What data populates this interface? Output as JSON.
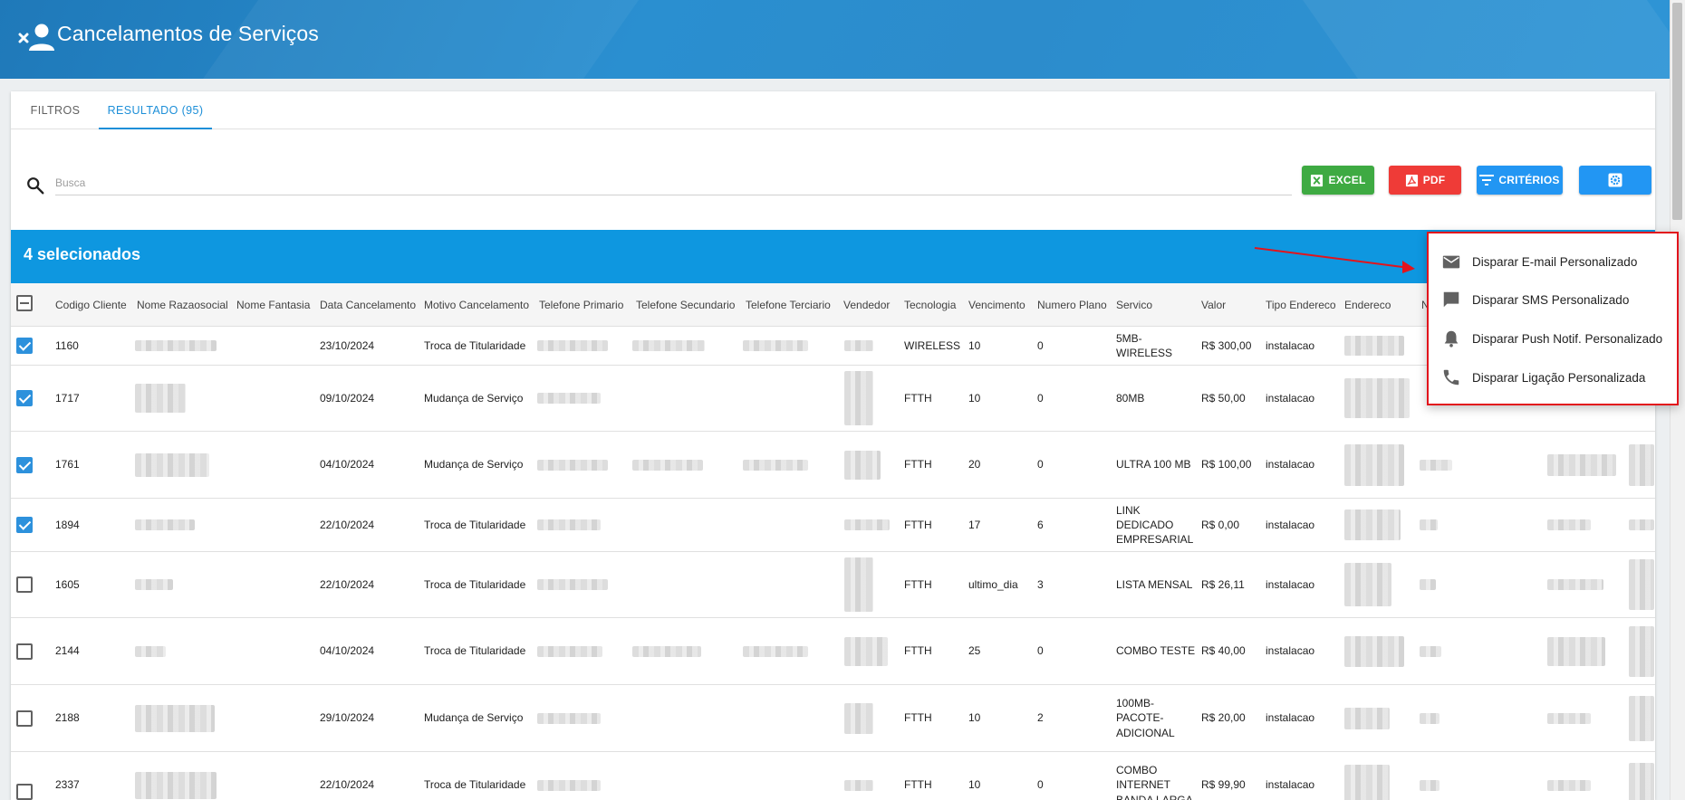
{
  "header": {
    "title": "Cancelamentos de Serviços"
  },
  "tabs": [
    {
      "label": "FILTROS"
    },
    {
      "label": "RESULTADO (95)"
    }
  ],
  "search": {
    "placeholder": "Busca",
    "value": ""
  },
  "toolbar": {
    "excel_label": "EXCEL",
    "pdf_label": "PDF",
    "criteria_label": "CRITÉRIOS"
  },
  "selection": {
    "text": "4 selecionados"
  },
  "table": {
    "columns": [
      "Codigo Cliente",
      "Nome Razaosocial",
      "Nome Fantasia",
      "Data Cancelamento",
      "Motivo Cancelamento",
      "Telefone Primario",
      "Telefone Secundario",
      "Telefone Terciario",
      "Vendedor",
      "Tecnologia",
      "Vencimento",
      "Numero Plano",
      "Servico",
      "Valor",
      "Tipo Endereco",
      "Endereco",
      "N"
    ],
    "rows": [
      {
        "checked": true,
        "codigo": "1160",
        "data": "23/10/2024",
        "motivo": "Troca de Titularidade",
        "tecnologia": "WIRELESS",
        "vencimento": "10",
        "numero_plano": "0",
        "servico": "5MB-\nWIRELESS",
        "valor": "R$ 300,00",
        "tipo_endereco": "instalacao"
      },
      {
        "checked": true,
        "codigo": "1717",
        "data": "09/10/2024",
        "motivo": "Mudança de Serviço",
        "tecnologia": "FTTH",
        "vencimento": "10",
        "numero_plano": "0",
        "servico": "80MB",
        "valor": "R$ 50,00",
        "tipo_endereco": "instalacao"
      },
      {
        "checked": true,
        "codigo": "1761",
        "data": "04/10/2024",
        "motivo": "Mudança de Serviço",
        "tecnologia": "FTTH",
        "vencimento": "20",
        "numero_plano": "0",
        "servico": "ULTRA 100 MB",
        "valor": "R$ 100,00",
        "tipo_endereco": "instalacao"
      },
      {
        "checked": true,
        "codigo": "1894",
        "data": "22/10/2024",
        "motivo": "Troca de Titularidade",
        "tecnologia": "FTTH",
        "vencimento": "17",
        "numero_plano": "6",
        "servico": "LINK\nDEDICADO\nEMPRESARIAL",
        "valor": "R$ 0,00",
        "tipo_endereco": "instalacao"
      },
      {
        "checked": false,
        "codigo": "1605",
        "data": "22/10/2024",
        "motivo": "Troca de Titularidade",
        "tecnologia": "FTTH",
        "vencimento": "ultimo_dia",
        "numero_plano": "3",
        "servico": "LISTA MENSAL",
        "valor": "R$ 26,11",
        "tipo_endereco": "instalacao"
      },
      {
        "checked": false,
        "codigo": "2144",
        "data": "04/10/2024",
        "motivo": "Troca de Titularidade",
        "tecnologia": "FTTH",
        "vencimento": "25",
        "numero_plano": "0",
        "servico": "COMBO TESTE",
        "valor": "R$ 40,00",
        "tipo_endereco": "instalacao"
      },
      {
        "checked": false,
        "codigo": "2188",
        "data": "29/10/2024",
        "motivo": "Mudança de Serviço",
        "tecnologia": "FTTH",
        "vencimento": "10",
        "numero_plano": "2",
        "servico": "100MB-\nPACOTE-\nADICIONAL",
        "valor": "R$ 20,00",
        "tipo_endereco": "instalacao"
      },
      {
        "checked": false,
        "codigo": "2337",
        "data": "22/10/2024",
        "motivo": "Troca de Titularidade",
        "tecnologia": "FTTH",
        "vencimento": "10",
        "numero_plano": "0",
        "servico": "COMBO\nINTERNET\nBANDA LARGA",
        "valor": "R$ 99,90",
        "tipo_endereco": "instalacao"
      }
    ]
  },
  "menu": {
    "items": [
      {
        "label": "Disparar E-mail Personalizado",
        "icon": "email-icon"
      },
      {
        "label": "Disparar SMS Personalizado",
        "icon": "sms-icon"
      },
      {
        "label": "Disparar Push Notif. Personalizado",
        "icon": "bell-icon"
      },
      {
        "label": "Disparar Ligação Personalizada",
        "icon": "phone-icon"
      }
    ]
  },
  "colors": {
    "header": "#2a8fd0",
    "accent": "#0e97e0",
    "excel": "#3eaa42",
    "pdf": "#ef3b37",
    "menu_highlight": "#e2141c"
  }
}
